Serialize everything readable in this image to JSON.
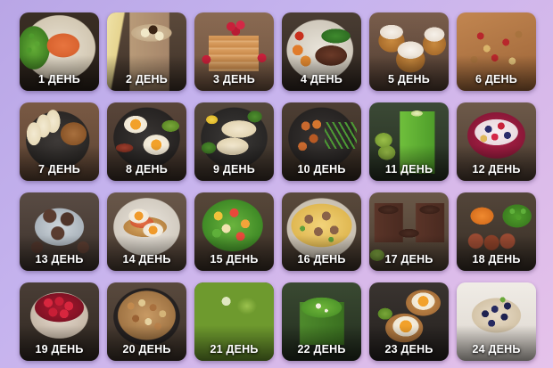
{
  "tiles": [
    {
      "label": "1 ДЕНЬ",
      "dish": "salmon-peas-icon"
    },
    {
      "label": "2 ДЕНЬ",
      "dish": "banana-smoothie-icon"
    },
    {
      "label": "3 ДЕНЬ",
      "dish": "pancakes-raspberries-icon"
    },
    {
      "label": "4 ДЕНЬ",
      "dish": "steak-vegetables-icon"
    },
    {
      "label": "5 ДЕНЬ",
      "dish": "muffins-cream-icon"
    },
    {
      "label": "6 ДЕНЬ",
      "dish": "nut-bar-icon"
    },
    {
      "label": "7 ДЕНЬ",
      "dish": "apple-nut-butter-icon"
    },
    {
      "label": "8 ДЕНЬ",
      "dish": "fried-eggs-avocado-icon"
    },
    {
      "label": "9 ДЕНЬ",
      "dish": "fish-broccoli-icon"
    },
    {
      "label": "10 ДЕНЬ",
      "dish": "chicken-green-beans-icon"
    },
    {
      "label": "11 ДЕНЬ",
      "dish": "green-smoothie-kiwi-icon"
    },
    {
      "label": "12 ДЕНЬ",
      "dish": "yogurt-berries-icon"
    },
    {
      "label": "13 ДЕНЬ",
      "dish": "energy-balls-icon"
    },
    {
      "label": "14 ДЕНЬ",
      "dish": "poached-eggs-salmon-icon"
    },
    {
      "label": "15 ДЕНЬ",
      "dish": "vegetable-salad-icon"
    },
    {
      "label": "16 ДЕНЬ",
      "dish": "mushroom-omelette-icon"
    },
    {
      "label": "17 ДЕНЬ",
      "dish": "chocolate-pudding-icon"
    },
    {
      "label": "18 ДЕНЬ",
      "dish": "meatballs-peas-icon"
    },
    {
      "label": "19 ДЕНЬ",
      "dish": "raspberry-bowl-icon"
    },
    {
      "label": "20 ДЕНЬ",
      "dish": "mixed-nuts-icon"
    },
    {
      "label": "21 ДЕНЬ",
      "dish": "zucchini-noodles-icon"
    },
    {
      "label": "22 ДЕНЬ",
      "dish": "green-soup-icon"
    },
    {
      "label": "23 ДЕНЬ",
      "dish": "egg-toast-icon"
    },
    {
      "label": "24 ДЕНЬ",
      "dish": "blueberry-casserole-icon"
    }
  ]
}
